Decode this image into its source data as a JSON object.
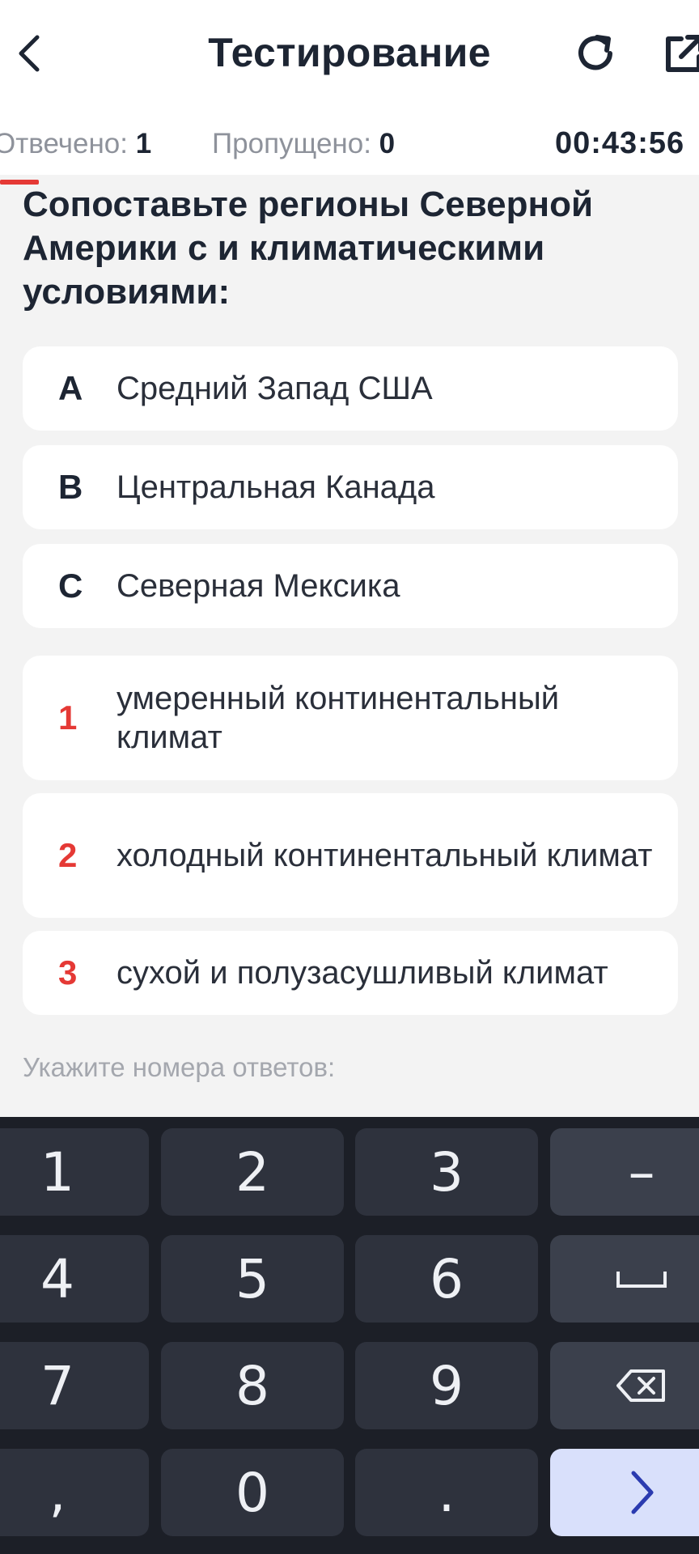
{
  "header": {
    "title": "Тестирование",
    "icons": {
      "back": "chevron-left-icon",
      "reload": "reload-icon",
      "share": "share-icon"
    }
  },
  "stats": {
    "answered_label": "Отвечено:",
    "answered_value": "1",
    "skipped_label": "Пропущено:",
    "skipped_value": "0",
    "timer": "00:43:56"
  },
  "question": "Сопоставьте регионы Северной Америки с и климатическими условиями:",
  "options": [
    {
      "key": "A",
      "text": "Средний Запад США"
    },
    {
      "key": "B",
      "text": "Центральная Канада"
    },
    {
      "key": "C",
      "text": "Северная Мексика"
    }
  ],
  "matches": [
    {
      "key": "1",
      "text": "умеренный континентальный климат"
    },
    {
      "key": "2",
      "text": "холодный континентальный климат"
    },
    {
      "key": "3",
      "text": "сухой и полузасушливый климат"
    }
  ],
  "answer_hint": "Укажите номера ответов:",
  "keyboard": {
    "keys": [
      "1",
      "2",
      "3",
      "4",
      "5",
      "6",
      "7",
      "8",
      "9",
      ",",
      "0",
      "."
    ],
    "minus": "–",
    "icons": {
      "space": "space-icon",
      "backspace": "backspace-icon",
      "enter": "chevron-right-icon"
    }
  },
  "colors": {
    "accent": "#e53935",
    "dark_text": "#1d2533",
    "keyboard_bg": "#1c1f27",
    "enter_key": "#d9e0fb"
  }
}
